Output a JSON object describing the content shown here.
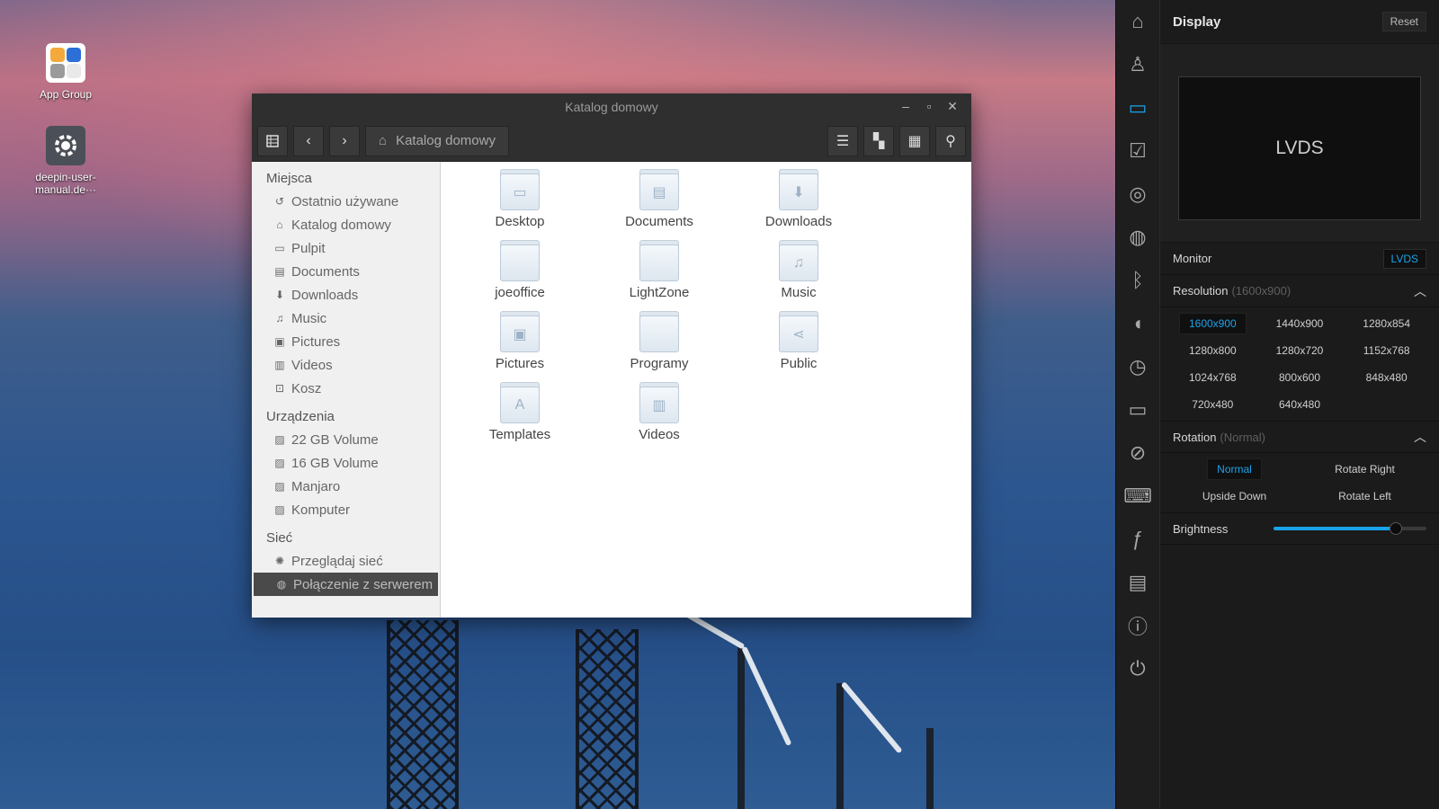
{
  "desktop": {
    "icons": [
      {
        "label": "App Group"
      },
      {
        "label": "deepin-user-manual.de···"
      }
    ]
  },
  "file_manager": {
    "title": "Katalog domowy",
    "breadcrumb": "Katalog domowy",
    "sidebar": {
      "places_heading": "Miejsca",
      "places": [
        {
          "label": "Ostatnio używane",
          "icon": "recent-icon"
        },
        {
          "label": "Katalog domowy",
          "icon": "home-icon"
        },
        {
          "label": "Pulpit",
          "icon": "desktop-icon"
        },
        {
          "label": "Documents",
          "icon": "document-icon"
        },
        {
          "label": "Downloads",
          "icon": "download-icon"
        },
        {
          "label": "Music",
          "icon": "music-icon"
        },
        {
          "label": "Pictures",
          "icon": "picture-icon"
        },
        {
          "label": "Videos",
          "icon": "video-icon"
        },
        {
          "label": "Kosz",
          "icon": "trash-icon"
        }
      ],
      "devices_heading": "Urządzenia",
      "devices": [
        {
          "label": "22 GB Volume"
        },
        {
          "label": "16 GB Volume"
        },
        {
          "label": "Manjaro"
        },
        {
          "label": "Komputer"
        }
      ],
      "network_heading": "Sieć",
      "network": [
        {
          "label": "Przeglądaj sieć"
        },
        {
          "label": "Połączenie z serwerem"
        }
      ]
    },
    "files": [
      {
        "label": "Desktop",
        "icon": "desktop-folder-icon"
      },
      {
        "label": "Documents",
        "icon": "documents-folder-icon"
      },
      {
        "label": "Downloads",
        "icon": "downloads-folder-icon"
      },
      {
        "label": "joeoffice",
        "icon": "folder-icon"
      },
      {
        "label": "LightZone",
        "icon": "folder-icon"
      },
      {
        "label": "Music",
        "icon": "music-folder-icon"
      },
      {
        "label": "Pictures",
        "icon": "pictures-folder-icon"
      },
      {
        "label": "Programy",
        "icon": "folder-icon"
      },
      {
        "label": "Public",
        "icon": "public-folder-icon"
      },
      {
        "label": "Templates",
        "icon": "templates-folder-icon"
      },
      {
        "label": "Videos",
        "icon": "videos-folder-icon"
      }
    ]
  },
  "panel": {
    "title": "Display",
    "reset_label": "Reset",
    "preview_label": "LVDS",
    "monitor_label": "Monitor",
    "monitor_value": "LVDS",
    "resolution_label": "Resolution",
    "resolution_current": "(1600x900)",
    "resolutions": [
      "1600x900",
      "1440x900",
      "1280x854",
      "1280x800",
      "1280x720",
      "1152x768",
      "1024x768",
      "800x600",
      "848x480",
      "720x480",
      "640x480"
    ],
    "rotation_label": "Rotation",
    "rotation_current": "(Normal)",
    "rotations": [
      "Normal",
      "Rotate Right",
      "Upside Down",
      "Rotate Left"
    ],
    "brightness_label": "Brightness",
    "brightness_value": 0.8
  },
  "colors": {
    "accent": "#19a3ea",
    "panel_bg": "#1b1b1b",
    "dock_bg": "#1e1e1e"
  }
}
